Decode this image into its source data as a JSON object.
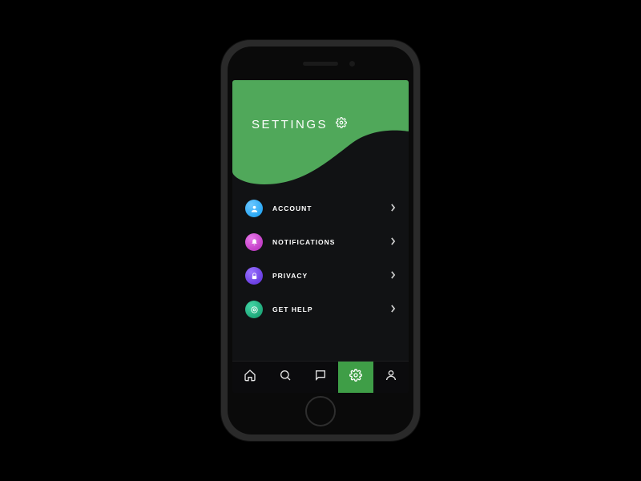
{
  "header": {
    "title": "SETTINGS",
    "icon": "gear-icon",
    "bg_color": "#50A85A"
  },
  "menu": [
    {
      "label": "ACCOUNT",
      "icon": "person-icon",
      "icon_color": "#2BA8F5"
    },
    {
      "label": "NOTIFICATIONS",
      "icon": "bell-icon",
      "icon_color": "#C23FC6"
    },
    {
      "label": "PRIVACY",
      "icon": "lock-icon",
      "icon_color": "#6B3FE3"
    },
    {
      "label": "GET HELP",
      "icon": "help-icon",
      "icon_color": "#1FA87A"
    }
  ],
  "navbar": {
    "items": [
      {
        "icon": "home-icon",
        "active": false
      },
      {
        "icon": "search-icon",
        "active": false
      },
      {
        "icon": "chat-icon",
        "active": false
      },
      {
        "icon": "gear-icon",
        "active": true
      },
      {
        "icon": "profile-icon",
        "active": false
      }
    ],
    "active_color": "#3f9e47"
  }
}
